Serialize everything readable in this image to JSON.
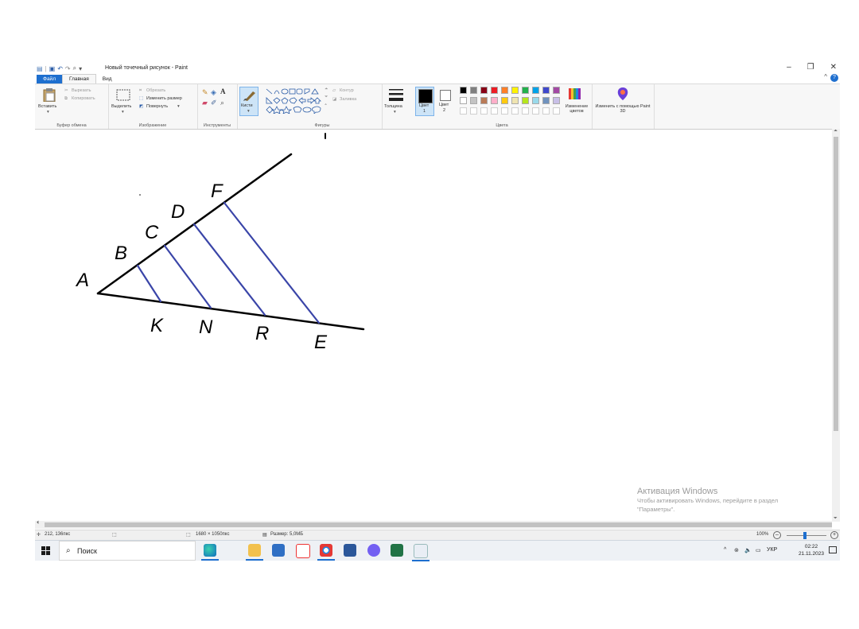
{
  "window": {
    "title": "Новый точечный рисунок - Paint",
    "qat_separator": "|",
    "minimize": "–",
    "restore": "❐",
    "close": "✕",
    "help": "?",
    "collapse_caret": "^"
  },
  "tabs": [
    "Файл",
    "Главная",
    "Вид"
  ],
  "ribbon": {
    "clipboard": {
      "paste": "Вставить",
      "cut": "Вырезать",
      "copy": "Копировать",
      "label": "Буфер обмена"
    },
    "image": {
      "select": "Выделить",
      "crop": "Обрезать",
      "resize": "Изменить размер",
      "rotate": "Повернуть",
      "label": "Изображение"
    },
    "tools": {
      "label": "Инструменты",
      "text_tool": "A"
    },
    "brushes": {
      "label": "Кисти"
    },
    "shapes": {
      "outline": "Контур",
      "fill": "Заливка",
      "label": "Фигуры"
    },
    "size": {
      "label": "Толщина"
    },
    "colors": {
      "color1_label": "Цвет",
      "color1_num": "1",
      "color2_label": "Цвет",
      "color2_num": "2",
      "edit": "Изменение цветов",
      "label": "Цвета",
      "palette_row1": [
        "#000000",
        "#7f7f7f",
        "#880015",
        "#ed1c24",
        "#ff7f27",
        "#fff200",
        "#22b14c",
        "#00a2e8",
        "#3f48cc",
        "#a349a4"
      ],
      "palette_row2": [
        "#ffffff",
        "#c3c3c3",
        "#b97a57",
        "#ffaec9",
        "#ffc90e",
        "#efe4b0",
        "#b5e61d",
        "#99d9ea",
        "#7092be",
        "#c8bfe7"
      ],
      "primary": "#000000",
      "secondary": "#ffffff"
    },
    "paint3d": {
      "label": "Изменить с помощью Paint 3D"
    }
  },
  "drawing": {
    "labels": {
      "A": "A",
      "B": "B",
      "C": "C",
      "D": "D",
      "F": "F",
      "K": "K",
      "N": "N",
      "R": "R",
      "E": "E"
    },
    "stroke_black": "#000000",
    "stroke_blue": "#3a45a8"
  },
  "activation": {
    "title": "Активация Windows",
    "line1": "Чтобы активировать Windows, перейдите в раздел",
    "line2": "\"Параметры\"."
  },
  "status": {
    "cursor": "212, 136пкс",
    "dimensions": "1680 × 1050пкс",
    "size": "Размер: 5,0МБ",
    "zoom": "100%",
    "zoom_minus": "–",
    "zoom_plus": "+"
  },
  "taskbar": {
    "search_placeholder": "Поиск",
    "tray_chevron": "^",
    "language": "УКР",
    "time": "02:22",
    "date": "21.11.2023"
  }
}
